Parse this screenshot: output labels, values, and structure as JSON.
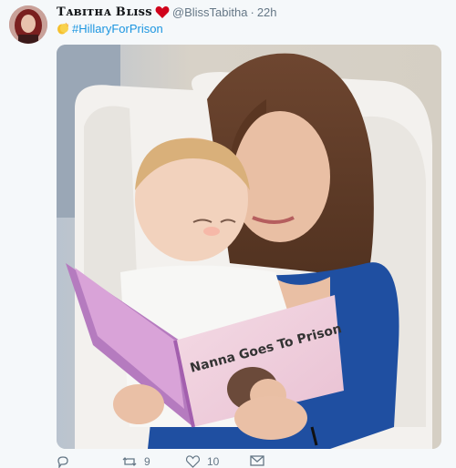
{
  "tweet": {
    "display_name": "Tᴀʙɪᴛʜᴀ Bʟɪss",
    "handle": "@BlissTabitha",
    "separator": "·",
    "time": "22h",
    "text": {
      "emoji_icon": "clapping-hands-icon",
      "hashtag": "#HillaryForPrison"
    },
    "verified_heart_color": "#d0021b",
    "media": {
      "book_title": "Nanna Goes To Prison"
    },
    "actions": {
      "reply_count": "",
      "retweet_count": "9",
      "like_count": "10"
    }
  },
  "colors": {
    "background": "#f5f8fa",
    "link": "#1b95e0",
    "muted": "#657786"
  }
}
